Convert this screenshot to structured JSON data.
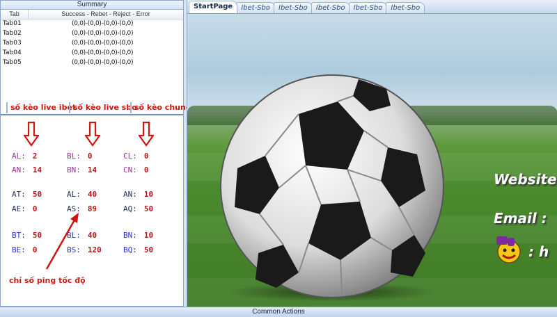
{
  "summary": {
    "title": "Summary",
    "columns": [
      "Tab",
      "Success - Rebet - Reject - Error"
    ],
    "rows": [
      {
        "tab": "Tab01",
        "value": "(0,0)-(0,0)-(0,0)-(0,0)"
      },
      {
        "tab": "Tab02",
        "value": "(0,0)-(0,0)-(0,0)-(0,0)"
      },
      {
        "tab": "Tab03",
        "value": "(0,0)-(0,0)-(0,0)-(0,0)"
      },
      {
        "tab": "Tab04",
        "value": "(0,0)-(0,0)-(0,0)-(0,0)"
      },
      {
        "tab": "Tab05",
        "value": "(0,0)-(0,0)-(0,0)-(0,0)"
      }
    ]
  },
  "left_tabs": [
    "số kèo live ibet",
    "số kèo live sbo",
    "số kèo chung"
  ],
  "stats": {
    "AL": {
      "label": "AL:",
      "value": "2"
    },
    "AN": {
      "label": "AN:",
      "value": "14"
    },
    "BL": {
      "label": "BL:",
      "value": "0"
    },
    "BN": {
      "label": "BN:",
      "value": "14"
    },
    "CL": {
      "label": "CL:",
      "value": "0"
    },
    "CN": {
      "label": "CN:",
      "value": "0"
    },
    "AT": {
      "label": "AT:",
      "value": "50"
    },
    "AE": {
      "label": "AE:",
      "value": "0"
    },
    "AL2": {
      "label": "AL:",
      "value": "40"
    },
    "AS": {
      "label": "AS:",
      "value": "89"
    },
    "AN2": {
      "label": "AN:",
      "value": "10"
    },
    "AQ": {
      "label": "AQ:",
      "value": "50"
    },
    "BT": {
      "label": "BT:",
      "value": "50"
    },
    "BE": {
      "label": "BE:",
      "value": "0"
    },
    "BL2": {
      "label": "BL:",
      "value": "40"
    },
    "BS": {
      "label": "BS:",
      "value": "120"
    },
    "BN2": {
      "label": "BN:",
      "value": "10"
    },
    "BQ": {
      "label": "BQ:",
      "value": "50"
    }
  },
  "annotation": "chỉ số ping tốc độ",
  "doc_tabs": [
    "StartPage",
    "Ibet-Sbo",
    "Ibet-Sbo",
    "Ibet-Sbo",
    "Ibet-Sbo",
    "Ibet-Sbo"
  ],
  "banner": {
    "website": "Website",
    "email": "Email : ",
    "yahoo": ": h"
  },
  "bottom": {
    "label": "Common Actions"
  },
  "colors": {
    "accent_red": "#d0140f",
    "label_purple": "#a02ba6",
    "label_blue": "#2a34b8"
  }
}
